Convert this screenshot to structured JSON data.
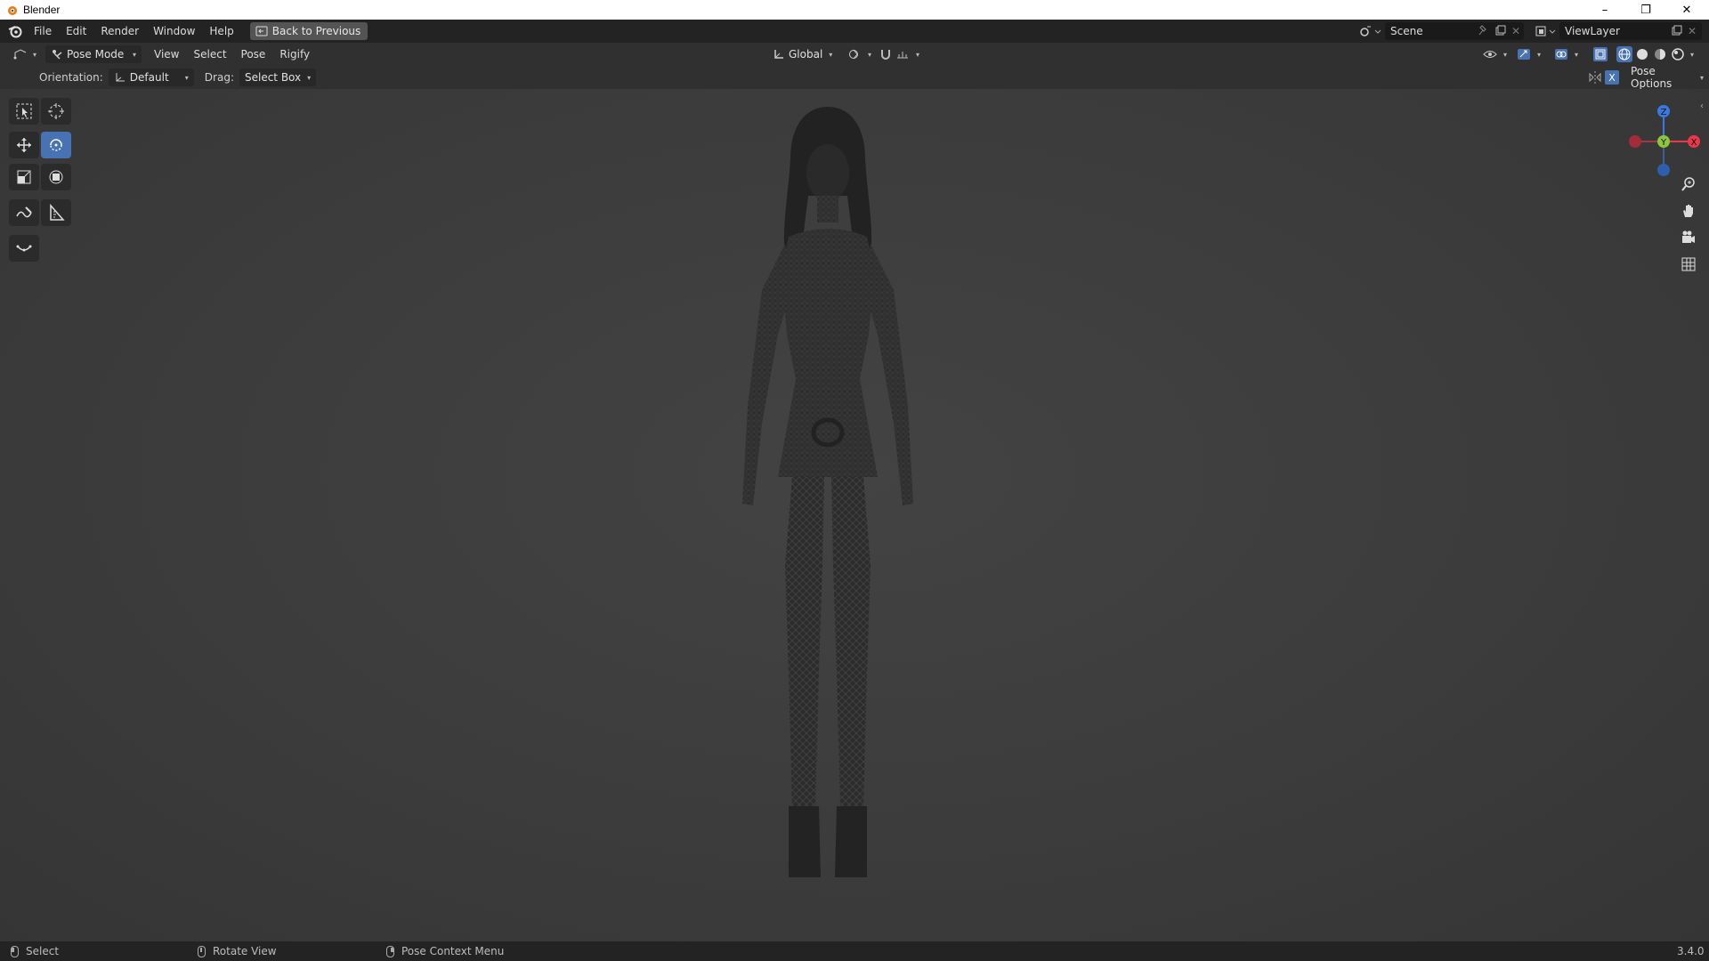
{
  "window": {
    "title": "Blender",
    "minimize": "–",
    "restore": "❐",
    "close": "✕"
  },
  "menu": {
    "file": "File",
    "edit": "Edit",
    "render": "Render",
    "window": "Window",
    "help": "Help",
    "back_to_previous": "Back to Previous"
  },
  "scene": {
    "name": "Scene",
    "view_layer": "ViewLayer"
  },
  "header": {
    "mode": "Pose Mode",
    "view": "View",
    "select": "Select",
    "pose": "Pose",
    "rigify": "Rigify",
    "transform_orientation": "Global"
  },
  "tool_settings": {
    "orientation_label": "Orientation:",
    "orientation_value": "Default",
    "drag_label": "Drag:",
    "drag_value": "Select Box",
    "pose_options": "Pose Options"
  },
  "gizmo": {
    "z": "Z",
    "y": "Y",
    "x": "X"
  },
  "status": {
    "select": "Select",
    "rotate_view": "Rotate View",
    "context_menu": "Pose Context Menu",
    "version": "3.4.0"
  },
  "colors": {
    "accent": "#4772b3",
    "axis_x": "#e8394a",
    "axis_y": "#8cc63f",
    "axis_z": "#3a7ae0"
  }
}
